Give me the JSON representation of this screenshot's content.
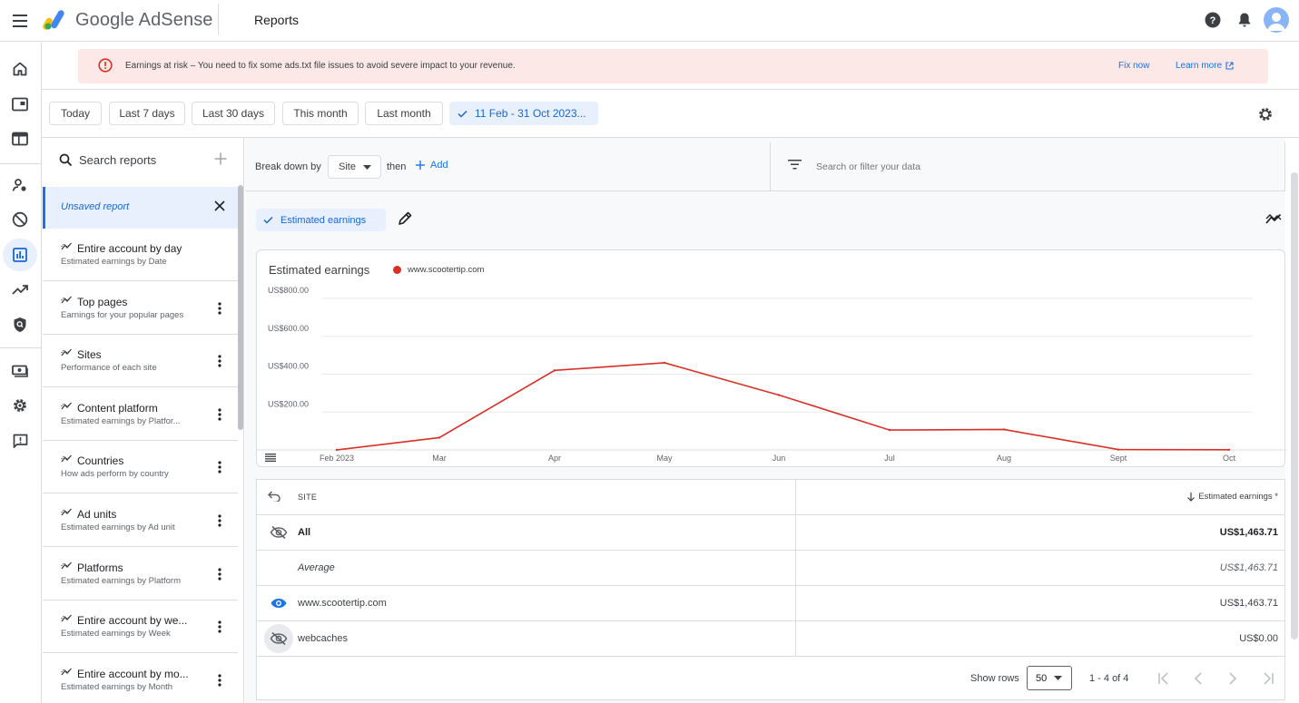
{
  "app": {
    "name": "Google AdSense",
    "page_title": "Reports"
  },
  "alert": {
    "text": "Earnings at risk – You need to fix some ads.txt file issues to avoid severe impact to your revenue.",
    "fix_label": "Fix now",
    "learn_label": "Learn more"
  },
  "date_chips": [
    {
      "label": "Today"
    },
    {
      "label": "Last 7 days"
    },
    {
      "label": "Last 30 days"
    },
    {
      "label": "This month"
    },
    {
      "label": "Last month"
    },
    {
      "label": "11 Feb - 31 Oct 2023..."
    }
  ],
  "sidebar": {
    "search_placeholder": "Search reports",
    "unsaved_label": "Unsaved report",
    "reports": [
      {
        "title": "Entire account by day",
        "subtitle": "Estimated earnings by Date"
      },
      {
        "title": "Top pages",
        "subtitle": "Earnings for your popular pages"
      },
      {
        "title": "Sites",
        "subtitle": "Performance of each site"
      },
      {
        "title": "Content platform",
        "subtitle": "Estimated earnings by Platfor..."
      },
      {
        "title": "Countries",
        "subtitle": "How ads perform by country"
      },
      {
        "title": "Ad units",
        "subtitle": "Estimated earnings by Ad unit"
      },
      {
        "title": "Platforms",
        "subtitle": "Estimated earnings by Platform"
      },
      {
        "title": "Entire account by we...",
        "subtitle": "Estimated earnings by Week"
      },
      {
        "title": "Entire account by mo...",
        "subtitle": "Estimated earnings by Month"
      }
    ]
  },
  "breakdown": {
    "label": "Break down by",
    "dimension": "Site",
    "then_label": "then",
    "add_label": "Add",
    "filter_placeholder": "Search or filter your data"
  },
  "metric_chip": "Estimated earnings",
  "chart_data": {
    "type": "line",
    "title": "Estimated earnings",
    "x": [
      "Feb 2023",
      "Mar",
      "Apr",
      "May",
      "Jun",
      "Jul",
      "Aug",
      "Sept",
      "Oct"
    ],
    "y_ticks": [
      "US$200.00",
      "US$400.00",
      "US$600.00",
      "US$800.00"
    ],
    "ylim": [
      0,
      800
    ],
    "grid": true,
    "legend": "top-left",
    "series": [
      {
        "name": "www.scootertip.com",
        "color": "#d93025",
        "values": [
          0,
          65,
          420,
          460,
          290,
          105,
          108,
          2,
          1
        ]
      }
    ]
  },
  "table": {
    "col_site": "SITE",
    "col_earnings": "Estimated earnings *",
    "rows": [
      {
        "site": "All",
        "value": "US$1,463.71"
      },
      {
        "site": "Average",
        "value": "US$1,463.71"
      },
      {
        "site": "www.scootertip.com",
        "value": "US$1,463.71"
      },
      {
        "site": "webcaches",
        "value": "US$0.00"
      }
    ]
  },
  "pager": {
    "show_rows_label": "Show rows",
    "rows_value": "50",
    "range": "1 - 4 of 4"
  },
  "colors": {
    "accent": "#1a73e8",
    "alert_bg": "#fce8e6",
    "series": "#d93025"
  }
}
